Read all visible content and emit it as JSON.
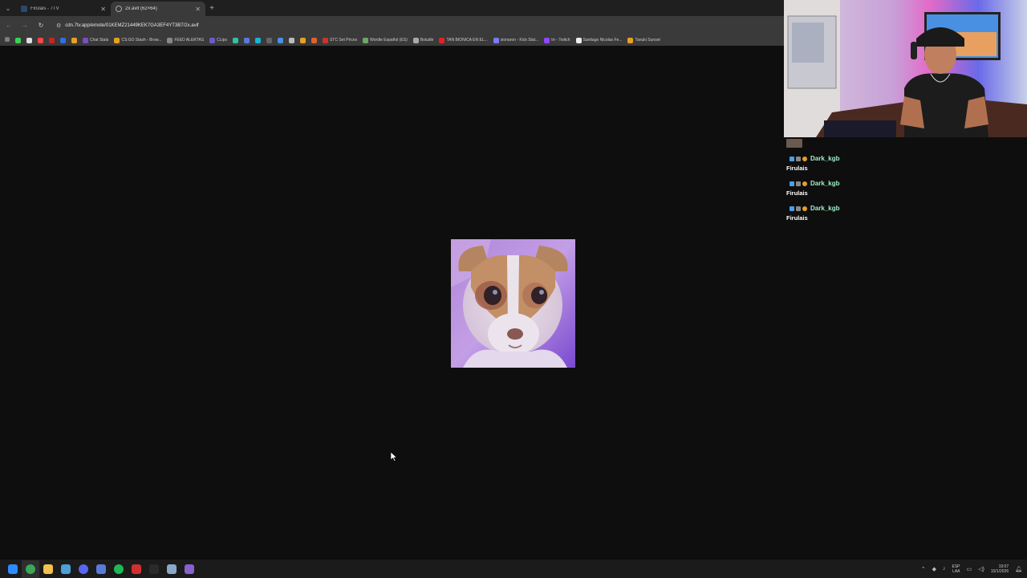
{
  "browser": {
    "tabs": [
      {
        "title": "Firulais - 7TV",
        "active": false
      },
      {
        "title": "2x.avif (62×64)",
        "active": true
      }
    ],
    "address_bar": {
      "url": "cdn.7tv.app/emote/01KEMZ21449KEK7GA3EF4YT3B7/2x.avif"
    },
    "bookmarks": [
      {
        "label": "",
        "color": "#39d353"
      },
      {
        "label": "",
        "color": "#dddddd"
      },
      {
        "label": "",
        "color": "#ff4444"
      },
      {
        "label": "",
        "color": "#cc2222"
      },
      {
        "label": "",
        "color": "#2f6fde"
      },
      {
        "label": "",
        "color": "#e8a020"
      },
      {
        "label": "Chat Stats",
        "color": "#7b4cc4"
      },
      {
        "label": "CS:GO Stash - Brow...",
        "color": "#e8a020"
      },
      {
        "label": "FEED ALERTAS",
        "color": "#888888"
      },
      {
        "label": "CLips",
        "color": "#6a5acd"
      },
      {
        "label": "",
        "color": "#2fc4a0"
      },
      {
        "label": "",
        "color": "#5a7ad8"
      },
      {
        "label": "",
        "color": "#18b4d8"
      },
      {
        "label": "",
        "color": "#666666"
      },
      {
        "label": "",
        "color": "#4a90e2"
      },
      {
        "label": "",
        "color": "#bbbbbb"
      },
      {
        "label": "",
        "color": "#e8a020"
      },
      {
        "label": "",
        "color": "#e06030"
      },
      {
        "label": "STC Set Prices",
        "color": "#d03030"
      },
      {
        "label": "Wordle Español (ES)",
        "color": "#6aaa64"
      },
      {
        "label": "Boludle",
        "color": "#aaaaaa"
      },
      {
        "label": "TAN BIONICA EN EL...",
        "color": "#e0202a"
      },
      {
        "label": "sionaron - Kick Stat...",
        "color": "#7a7aff"
      },
      {
        "label": "trr - Twitch",
        "color": "#9146ff"
      },
      {
        "label": "Santiago Nicolas Fe...",
        "color": "#eeeeee"
      },
      {
        "label": "Tanuki Sunset",
        "color": "#e8a020"
      }
    ]
  },
  "chat": {
    "messages": [
      {
        "username": "Dark_kgb",
        "text": "Firulais"
      },
      {
        "username": "Dark_kgb",
        "text": "Firulais"
      },
      {
        "username": "Dark_kgb",
        "text": "Firulais"
      }
    ]
  },
  "taskbar": {
    "apps": [
      {
        "icon": "windows-start-icon",
        "color": "#2b8cff"
      },
      {
        "icon": "chrome-icon",
        "color": "#3aa757"
      },
      {
        "icon": "file-explorer-icon",
        "color": "#f2c14e"
      },
      {
        "icon": "steam-icon",
        "color": "#4aa0d8"
      },
      {
        "icon": "discord-icon",
        "color": "#5865f2"
      },
      {
        "icon": "app-window-icon",
        "color": "#5a7ad8"
      },
      {
        "icon": "spotify-icon",
        "color": "#1db954"
      },
      {
        "icon": "news-app-icon",
        "color": "#d03030"
      },
      {
        "icon": "settings-icon",
        "color": "#2a2a2a"
      },
      {
        "icon": "obs-icon",
        "color": "#8aa8c8"
      },
      {
        "icon": "app-icon",
        "color": "#8860d0"
      }
    ],
    "tray": {
      "language_top": "ESP",
      "language_bottom": "LAA",
      "time": "19:07",
      "date": "10/1/2026"
    }
  }
}
